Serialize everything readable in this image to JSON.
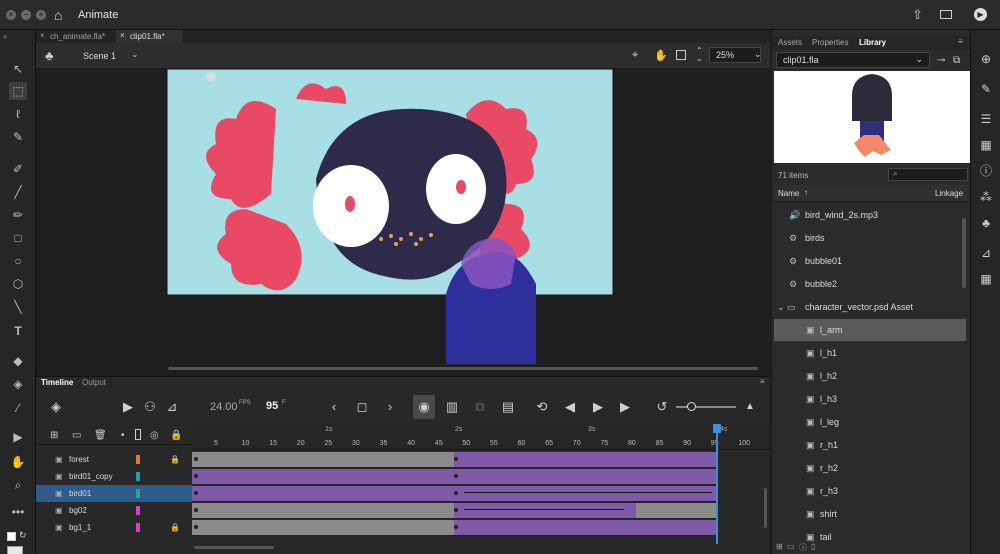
{
  "app": {
    "title": "Animate"
  },
  "tabs": [
    "ch_animate.fla*",
    "clip01.fla*"
  ],
  "scene": {
    "label": "Scene 1",
    "zoom": "25%"
  },
  "library": {
    "tabs": [
      "Assets",
      "Properties",
      "Library"
    ],
    "file": "clip01.fla",
    "item_count": "71 items",
    "col_name": "Name",
    "col_linkage": "Linkage",
    "items": [
      {
        "label": "bird_wind_2s.mp3",
        "icon": "sound-icon"
      },
      {
        "label": "birds",
        "icon": "movieclip-icon"
      },
      {
        "label": "bubble01",
        "icon": "movieclip-icon"
      },
      {
        "label": "bubble2",
        "icon": "movieclip-icon"
      },
      {
        "label": "character_vector.psd Asset",
        "icon": "folder-icon"
      },
      {
        "label": "l_arm",
        "icon": "bitmap-icon"
      },
      {
        "label": "l_h1",
        "icon": "bitmap-icon"
      },
      {
        "label": "l_h2",
        "icon": "bitmap-icon"
      },
      {
        "label": "l_h3",
        "icon": "bitmap-icon"
      },
      {
        "label": "l_leg",
        "icon": "bitmap-icon"
      },
      {
        "label": "r_h1",
        "icon": "bitmap-icon"
      },
      {
        "label": "r_h2",
        "icon": "bitmap-icon"
      },
      {
        "label": "r_h3",
        "icon": "bitmap-icon"
      },
      {
        "label": "shirt",
        "icon": "bitmap-icon"
      },
      {
        "label": "tail",
        "icon": "bitmap-icon"
      }
    ],
    "selected_index": 5
  },
  "timeline": {
    "tabs": [
      "Timeline",
      "Output"
    ],
    "fps": "24.00",
    "fps_unit": "FPS",
    "frame": "95",
    "frame_unit": "F",
    "seconds_marks": [
      "1s",
      "2s",
      "3s",
      "4s"
    ],
    "frame_ticks": [
      "5",
      "10",
      "15",
      "20",
      "25",
      "30",
      "35",
      "40",
      "45",
      "50",
      "55",
      "60",
      "65",
      "70",
      "75",
      "80",
      "85",
      "90",
      "95",
      "100"
    ],
    "layers": [
      {
        "name": "forest",
        "color": "#e07b2a",
        "locked": true
      },
      {
        "name": "bird01_copy",
        "color": "#2a9fa0",
        "locked": false
      },
      {
        "name": "bird01",
        "color": "#2a9fa0",
        "locked": false
      },
      {
        "name": "bg02",
        "color": "#d63fc9",
        "locked": false
      },
      {
        "name": "bg1_1",
        "color": "#d63fc9",
        "locked": true
      }
    ],
    "selected_layer": 2
  },
  "colors": {
    "stage_bg": "#a8dfe5",
    "accent": "#2c5c8c",
    "frame_purple": "#7f5aa8",
    "frame_gray": "#8b8b8b"
  }
}
